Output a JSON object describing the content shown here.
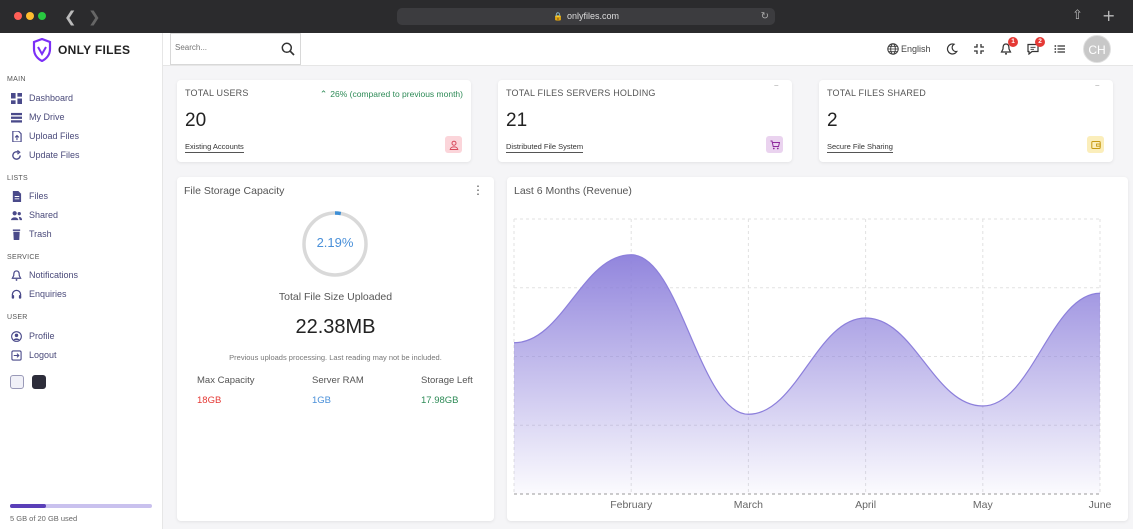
{
  "browser": {
    "url": "onlyfiles.com"
  },
  "brand": {
    "name": "ONLY FILES",
    "color": "#7b2ff7"
  },
  "sidebar": {
    "sections": [
      {
        "label": "MAIN",
        "items": [
          {
            "label": "Dashboard",
            "icon": "dashboard-icon"
          },
          {
            "label": "My Drive",
            "icon": "drive-icon"
          },
          {
            "label": "Upload Files",
            "icon": "upload-icon"
          },
          {
            "label": "Update Files",
            "icon": "refresh-icon"
          }
        ]
      },
      {
        "label": "LISTS",
        "items": [
          {
            "label": "Files",
            "icon": "file-icon"
          },
          {
            "label": "Shared",
            "icon": "users-icon"
          },
          {
            "label": "Trash",
            "icon": "trash-icon"
          }
        ]
      },
      {
        "label": "SERVICE",
        "items": [
          {
            "label": "Notifications",
            "icon": "bell-icon"
          },
          {
            "label": "Enquiries",
            "icon": "headset-icon"
          }
        ]
      },
      {
        "label": "USER",
        "items": [
          {
            "label": "Profile",
            "icon": "user-circle-icon"
          },
          {
            "label": "Logout",
            "icon": "logout-icon"
          }
        ]
      }
    ],
    "storage": {
      "used_fraction": 0.25,
      "text": "5 GB of 20 GB used"
    }
  },
  "topbar": {
    "search_placeholder": "Search...",
    "language": "English",
    "notifications_count": "1",
    "messages_count": "2",
    "avatar_initials": "CH"
  },
  "stats": [
    {
      "title": "TOTAL USERS",
      "value": "20",
      "link": "Existing Accounts",
      "trend": "26% (compared to previous month)",
      "icon": "user-icon",
      "icon_bg": "#fbd5da",
      "icon_color": "#d84a5c"
    },
    {
      "title": "TOTAL FILES SERVERS HOLDING",
      "value": "21",
      "link": "Distributed File System",
      "trend": "",
      "icon": "cart-icon",
      "icon_bg": "#ead3ef",
      "icon_color": "#8e2a9c"
    },
    {
      "title": "TOTAL FILES SHARED",
      "value": "2",
      "link": "Secure File Sharing",
      "trend": "",
      "icon": "wallet-icon",
      "icon_bg": "#fbeebb",
      "icon_color": "#c79a13"
    }
  ],
  "storage_card": {
    "title": "File Storage Capacity",
    "percent_label": "2.19%",
    "percent_value": 2.19,
    "uploaded_label": "Total File Size Uploaded",
    "uploaded_value": "22.38MB",
    "note": "Previous uploads processing. Last reading may not be included.",
    "specs": [
      {
        "label": "Max Capacity",
        "value": "18GB",
        "color": "#e53935"
      },
      {
        "label": "Server RAM",
        "value": "1GB",
        "color": "#4a90d9"
      },
      {
        "label": "Storage Left",
        "value": "17.98GB",
        "color": "#2e8b57"
      }
    ]
  },
  "chart_data": {
    "type": "area",
    "title": "Last 6 Months (Revenue)",
    "categories": [
      "",
      "February",
      "March",
      "April",
      "May",
      "June"
    ],
    "series": [
      {
        "values": [
          55,
          87,
          29,
          64,
          32,
          73
        ]
      }
    ],
    "ylim": [
      0,
      100
    ],
    "grid": true,
    "color": "#8c7fdb"
  }
}
